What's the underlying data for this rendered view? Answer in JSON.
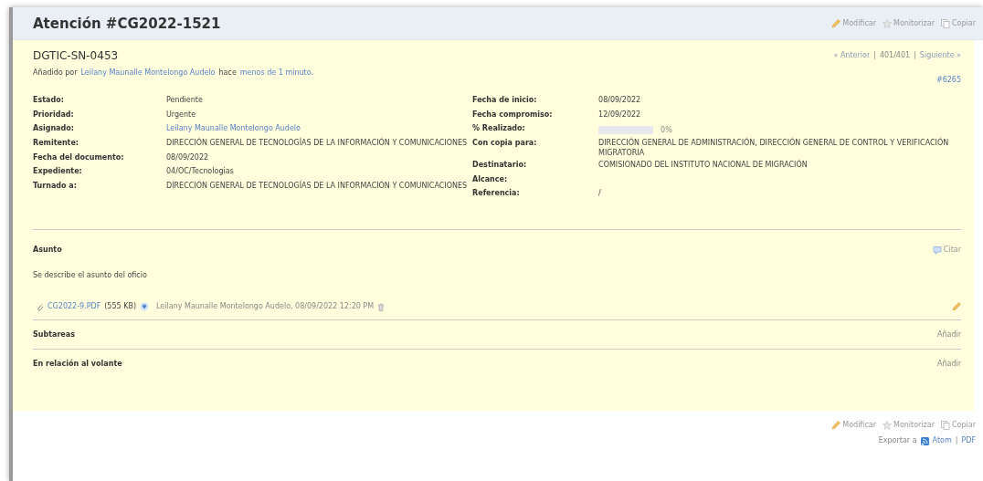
{
  "title": "Atención #CG2022-1521",
  "header_actions": [
    {
      "kind": "edit",
      "label": "Modificar"
    },
    {
      "kind": "watch",
      "label": "Monitorizar"
    },
    {
      "kind": "copy",
      "label": "Copiar"
    }
  ],
  "subject": "DGTIC-SN-0453",
  "nav": [
    {
      "kind": "link",
      "label": "« Anterior"
    },
    {
      "kind": "sep",
      "label": "|"
    },
    {
      "kind": "text",
      "label": "401/401"
    },
    {
      "kind": "sep",
      "label": "|"
    },
    {
      "kind": "link",
      "label": "Siguiente »"
    }
  ],
  "author_line": [
    {
      "kind": "text",
      "label": "Añadido por"
    },
    {
      "kind": "link",
      "label": "Leilany Maunalle Montelongo Audelo"
    },
    {
      "kind": "text",
      "label": "hace"
    },
    {
      "kind": "link",
      "label": "menos de 1 minuto."
    }
  ],
  "parent": "#6265",
  "attributes_left": [
    {
      "label": "Estado:",
      "kind": "text",
      "value": "Pendiente"
    },
    {
      "label": "Prioridad:",
      "kind": "text",
      "value": "Urgente"
    },
    {
      "label": "Asignado:",
      "kind": "link",
      "value": "Leilany Maunalle Montelongo Audelo"
    },
    {
      "label": "Remitente:",
      "kind": "text",
      "value": "DIRECCIÓN GENERAL DE TECNOLOGÍAS DE LA INFORMACIÓN Y COMUNICACIONES"
    },
    {
      "label": "Fecha del documento:",
      "kind": "text",
      "value": "08/09/2022"
    },
    {
      "label": "Expediente:",
      "kind": "text",
      "value": "04/OC/Tecnologias"
    },
    {
      "label": "Turnado a:",
      "kind": "text",
      "value": "DIRECCIÓN GENERAL DE TECNOLOGÍAS DE LA INFORMACIÓN Y COMUNICACIONES"
    }
  ],
  "attributes_right": [
    {
      "label": "Fecha de inicio:",
      "kind": "text",
      "value": "08/09/2022"
    },
    {
      "label": "Fecha compromiso:",
      "kind": "text",
      "value": "12/09/2022"
    },
    {
      "label": "% Realizado:",
      "kind": "progress",
      "level": 0,
      "value": "0%"
    },
    {
      "label": "Con copia para:",
      "kind": "text",
      "value": "DIRECCIÓN GENERAL DE ADMINISTRACIÓN, DIRECCIÓN GENERAL DE CONTROL Y VERIFICACIÓN MIGRATORIA"
    },
    {
      "label": "Destinatario:",
      "kind": "text",
      "value": "COMISIONADO DEL INSTITUTO NACIONAL DE MIGRACIÓN"
    },
    {
      "label": "Alcance:",
      "kind": "text"
    },
    {
      "label": "Referencia:",
      "kind": "text",
      "value": "/"
    }
  ],
  "description": {
    "title": "Asunto",
    "quote": "Citar",
    "text": "Se describe el asunto del oficio"
  },
  "attachment": {
    "file": "CG2022-9.PDF",
    "size": "(555 KB)",
    "author_date": "Leilany Maunalle Montelongo Audelo, 08/09/2022 12:20 PM"
  },
  "sections": [
    {
      "title": "Subtareas",
      "action": "Añadir"
    },
    {
      "title": "En relación al volante",
      "action": "Añadir"
    }
  ],
  "footer_actions": [
    {
      "kind": "edit",
      "label": "Modificar"
    },
    {
      "kind": "watch",
      "label": "Monitorizar"
    },
    {
      "kind": "copy",
      "label": "Copiar"
    }
  ],
  "export": [
    {
      "kind": "text",
      "label": "Exportar a"
    },
    {
      "kind": "atom",
      "label": "Atom"
    },
    {
      "kind": "sep",
      "label": "|"
    },
    {
      "kind": "link",
      "label": "PDF"
    }
  ]
}
